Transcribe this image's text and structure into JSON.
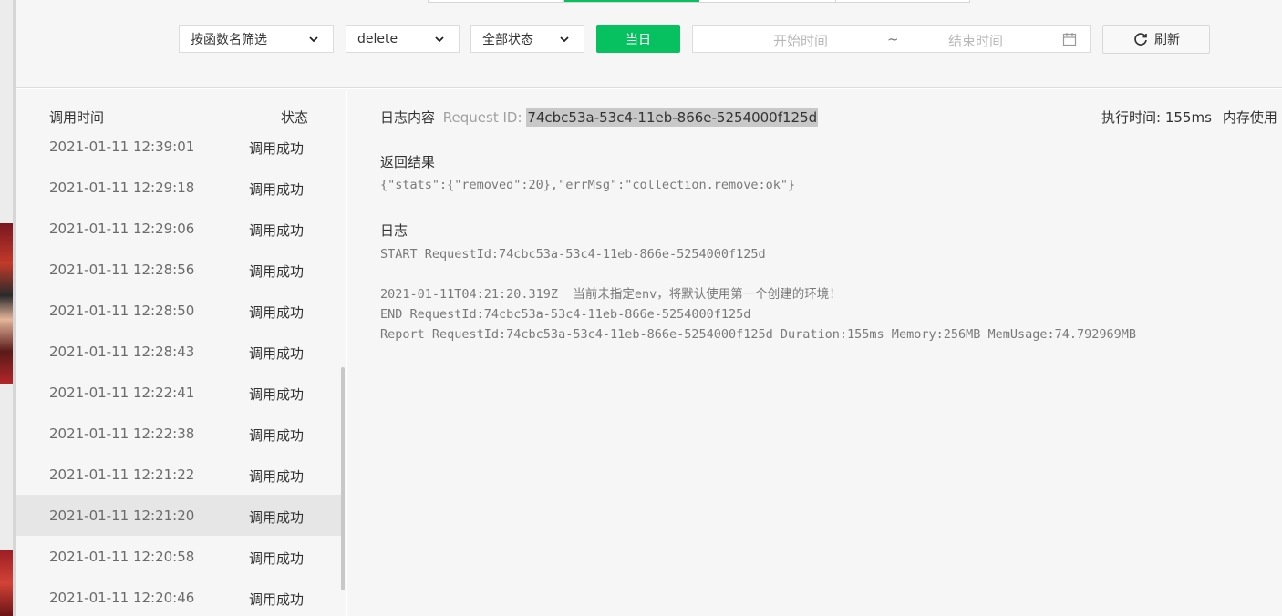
{
  "toolbar": {
    "func_filter": "按函数名筛选",
    "func_name": "delete",
    "status_filter": "全部状态",
    "today_label": "当日",
    "start_placeholder": "开始时间",
    "range_sep": "~",
    "end_placeholder": "结束时间",
    "refresh_label": "刷新"
  },
  "list": {
    "col_time": "调用时间",
    "col_status": "状态",
    "rows": [
      {
        "time": "2021-01-11 12:39:01",
        "status": "调用成功"
      },
      {
        "time": "2021-01-11 12:29:18",
        "status": "调用成功"
      },
      {
        "time": "2021-01-11 12:29:06",
        "status": "调用成功"
      },
      {
        "time": "2021-01-11 12:28:56",
        "status": "调用成功"
      },
      {
        "time": "2021-01-11 12:28:50",
        "status": "调用成功"
      },
      {
        "time": "2021-01-11 12:28:43",
        "status": "调用成功"
      },
      {
        "time": "2021-01-11 12:22:41",
        "status": "调用成功"
      },
      {
        "time": "2021-01-11 12:22:38",
        "status": "调用成功"
      },
      {
        "time": "2021-01-11 12:21:22",
        "status": "调用成功"
      },
      {
        "time": "2021-01-11 12:21:20",
        "status": "调用成功"
      },
      {
        "time": "2021-01-11 12:20:58",
        "status": "调用成功"
      },
      {
        "time": "2021-01-11 12:20:46",
        "status": "调用成功"
      }
    ]
  },
  "detail": {
    "title": "日志内容",
    "request_id_label": "Request ID:",
    "request_id": "74cbc53a-53c4-11eb-866e-5254000f125d",
    "exec_time": "执行时间: 155ms",
    "mem_usage": "内存使用",
    "result_title": "返回结果",
    "result": "{\"stats\":{\"removed\":20},\"errMsg\":\"collection.remove:ok\"}",
    "log_title": "日志",
    "log_lines": [
      "START RequestId:74cbc53a-53c4-11eb-866e-5254000f125d",
      "2021-01-11T04:21:20.319Z  当前未指定env，将默认使用第一个创建的环境！",
      "END RequestId:74cbc53a-53c4-11eb-866e-5254000f125d",
      "Report RequestId:74cbc53a-53c4-11eb-866e-5254000f125d Duration:155ms Memory:256MB MemUsage:74.792969MB"
    ]
  },
  "colors": {
    "accent": "#07c160",
    "selected_row": "#e6e6e6",
    "panel_bg": "#f6f6f6"
  }
}
